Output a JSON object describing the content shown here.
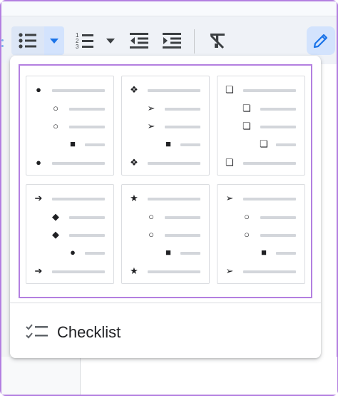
{
  "toolbar": {
    "buttons": [
      {
        "name": "bulleted-list",
        "icon": "bulleted-list-icon",
        "active": true
      },
      {
        "name": "bulleted-list-menu",
        "icon": "chevron-down-icon",
        "active": true
      },
      {
        "name": "numbered-list",
        "icon": "numbered-list-icon"
      },
      {
        "name": "numbered-list-menu",
        "icon": "chevron-down-icon"
      },
      {
        "name": "decrease-indent",
        "icon": "decrease-indent-icon"
      },
      {
        "name": "increase-indent",
        "icon": "increase-indent-icon"
      },
      {
        "name": "clear-formatting",
        "icon": "clear-formatting-icon"
      },
      {
        "name": "editing-mode",
        "icon": "pencil-icon",
        "active": true
      }
    ],
    "accent_color": "#1a73e8",
    "active_bg": "#d3e3fd"
  },
  "bullet_menu": {
    "presets": [
      {
        "name": "disc-circle-square",
        "glyphs": [
          "●",
          "○",
          "○",
          "■",
          "●"
        ]
      },
      {
        "name": "diamond-arrow-square",
        "glyphs": [
          "❖",
          "➢",
          "➢",
          "■",
          "❖"
        ]
      },
      {
        "name": "3d-box",
        "glyphs": [
          "❏",
          "❏",
          "❏",
          "❏",
          "❏"
        ]
      },
      {
        "name": "arrow-diamond-disc",
        "glyphs": [
          "➔",
          "◆",
          "◆",
          "●",
          "➔"
        ]
      },
      {
        "name": "star-circle-square",
        "glyphs": [
          "★",
          "○",
          "○",
          "■",
          "★"
        ]
      },
      {
        "name": "arrowhead-circle-square",
        "glyphs": [
          "➢",
          "○",
          "○",
          "■",
          "➢"
        ]
      }
    ],
    "checklist_label": "Checklist",
    "highlight_color": "#b37fe0"
  }
}
